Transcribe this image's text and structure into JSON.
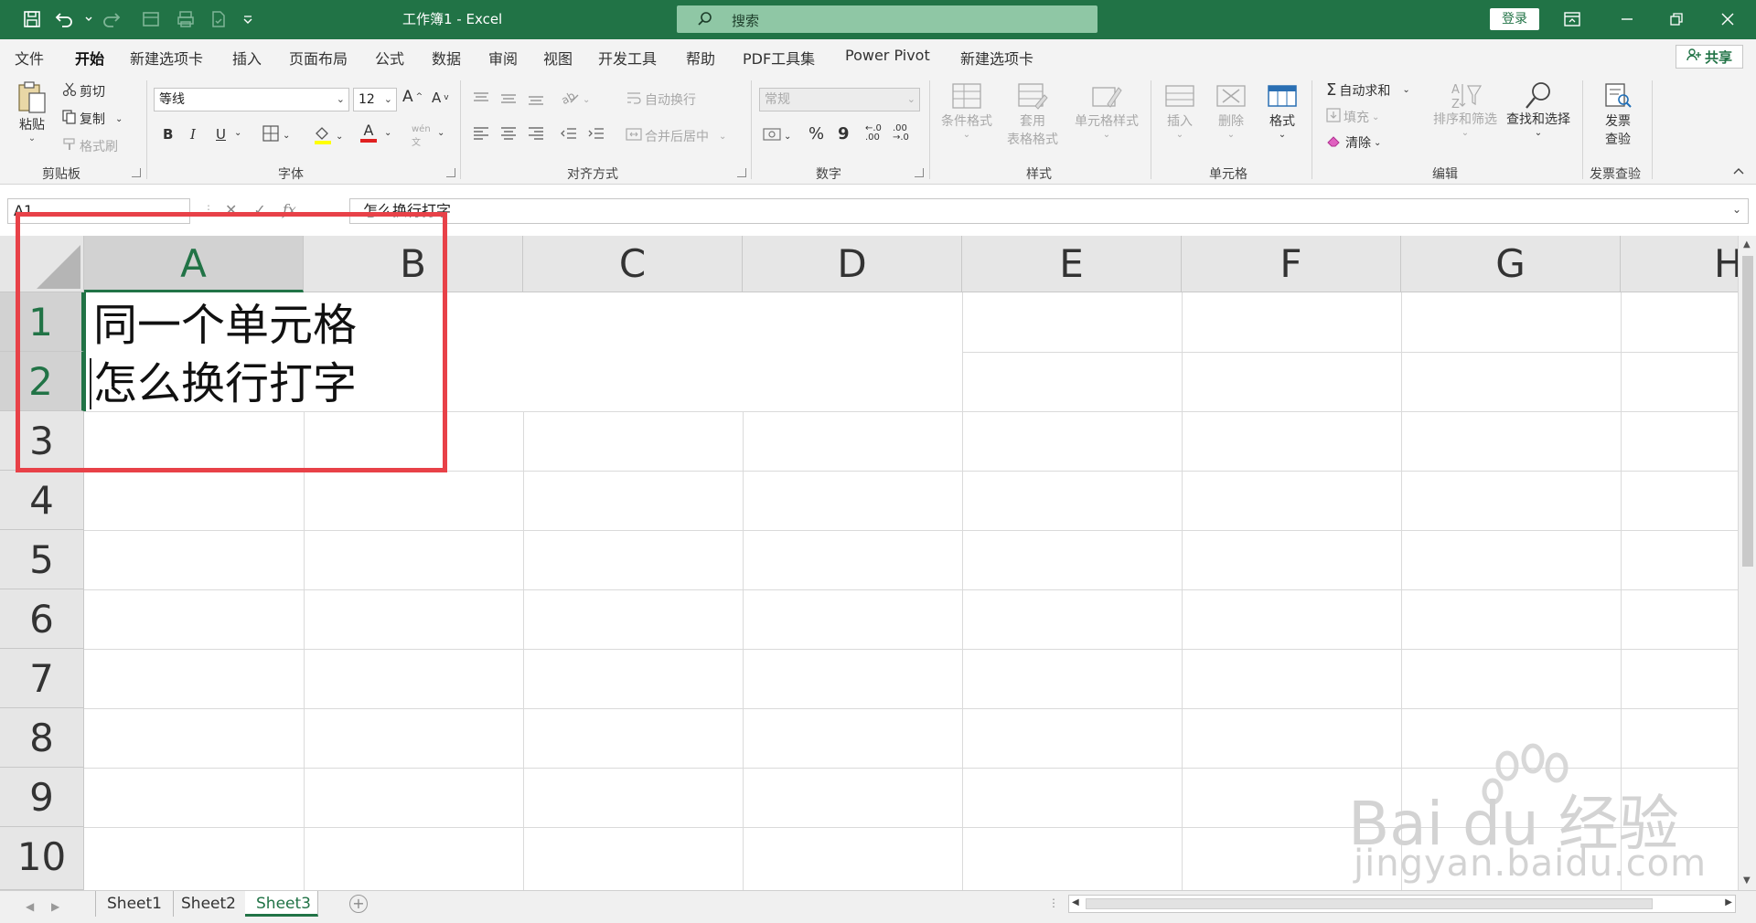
{
  "window": {
    "title": "工作簿1 - Excel",
    "search_label": "搜索",
    "login_label": "登录"
  },
  "tabs": [
    {
      "label": "文件"
    },
    {
      "label": "开始",
      "active": true
    },
    {
      "label": "新建选项卡"
    },
    {
      "label": "插入"
    },
    {
      "label": "页面布局"
    },
    {
      "label": "公式"
    },
    {
      "label": "数据"
    },
    {
      "label": "审阅"
    },
    {
      "label": "视图"
    },
    {
      "label": "开发工具"
    },
    {
      "label": "帮助"
    },
    {
      "label": "PDF工具集"
    },
    {
      "label": "Power Pivot"
    },
    {
      "label": "新建选项卡"
    }
  ],
  "share_label": "共享",
  "ribbon": {
    "clipboard": {
      "paste": "粘贴",
      "cut": "剪切",
      "copy": "复制",
      "format_painter": "格式刷",
      "label": "剪贴板"
    },
    "font": {
      "font_name": "等线",
      "font_size": "12",
      "bold": "B",
      "italic": "I",
      "underline": "U",
      "font_color_glyph": "A",
      "label": "字体"
    },
    "alignment": {
      "wrap_text": "自动换行",
      "merge_center": "合并后居中",
      "label": "对齐方式"
    },
    "number": {
      "format": "常规",
      "percent": "%",
      "comma": "9",
      "label": "数字"
    },
    "styles": {
      "conditional": "条件格式",
      "table_format_1": "套用",
      "table_format_2": "表格格式",
      "cell_styles": "单元格样式",
      "label": "样式"
    },
    "cells": {
      "insert": "插入",
      "delete": "删除",
      "format": "格式",
      "label": "单元格"
    },
    "editing": {
      "autosum": "自动求和",
      "fill": "填充",
      "clear": "清除",
      "sort_filter": "排序和筛选",
      "find_select": "查找和选择",
      "label": "编辑"
    },
    "invoice": {
      "check_1": "发票",
      "check_2": "查验",
      "label": "发票查验"
    }
  },
  "formula_bar": {
    "name_box": "A1",
    "cancel": "✕",
    "enter": "✓",
    "fx": "fx",
    "content": "怎么换行打字"
  },
  "columns": [
    "A",
    "B",
    "C",
    "D",
    "E",
    "F",
    "G",
    "H"
  ],
  "rows": [
    "1",
    "2",
    "3",
    "4",
    "5",
    "6",
    "7",
    "8",
    "9",
    "10"
  ],
  "cell_a1": {
    "line1": "同一个单元格",
    "line2": "怎么换行打字"
  },
  "sheets": [
    {
      "label": "Sheet1"
    },
    {
      "label": "Sheet2"
    },
    {
      "label": "Sheet3",
      "active": true
    }
  ],
  "add_sheet": "+",
  "watermark": {
    "brand": "Bai du 经验",
    "url": "jingyan.baidu.com"
  },
  "colors": {
    "excel_green": "#217346",
    "annotation_red": "#e84148"
  }
}
